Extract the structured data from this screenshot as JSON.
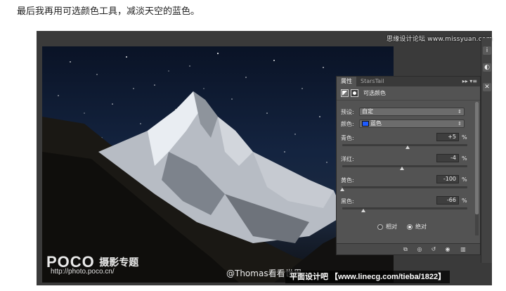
{
  "caption": "最后我再用可选颜色工具，减淡天空的蓝色。",
  "watermark_top": "思缘设计论坛 www.missyuan.com",
  "photo": {
    "logo_brand": "POCO",
    "logo_brand_cn": "摄影专题",
    "logo_url": "http://photo.poco.cn/",
    "credit": "@Thomas看看世界",
    "source_banner": "平面设计吧 【www.linecg.com/tieba/1822】"
  },
  "panel": {
    "tabs": [
      "属性",
      "StarsTail"
    ],
    "controls": "▸▸  ▾≡",
    "title": "可选颜色",
    "preset_label": "预设:",
    "preset_value": "自定",
    "color_label": "颜色:",
    "color_value": "蓝色",
    "color_swatch": "#1e5bff",
    "sliders": [
      {
        "label": "青色:",
        "value": "+5",
        "unit": "%",
        "level": 0.52
      },
      {
        "label": "洋红:",
        "value": "-4",
        "unit": "%",
        "level": 0.48
      },
      {
        "label": "黄色:",
        "value": "-100",
        "unit": "%",
        "level": 0.0
      },
      {
        "label": "黑色:",
        "value": "-66",
        "unit": "%",
        "level": 0.17
      }
    ],
    "method_options": [
      "相对",
      "绝对"
    ],
    "method_selected": "绝对",
    "bottom_tools": [
      "clip-to-layer-icon",
      "view-previous-icon",
      "reset-icon",
      "visibility-eye-icon",
      "trash-icon"
    ]
  },
  "side_strip_icons": [
    "info-icon",
    "adjust-icon",
    "close-icon"
  ],
  "colors": {
    "panel_bg": "#535353",
    "workspace_bg": "#3a3a3a",
    "accent_blue": "#1e5bff"
  }
}
